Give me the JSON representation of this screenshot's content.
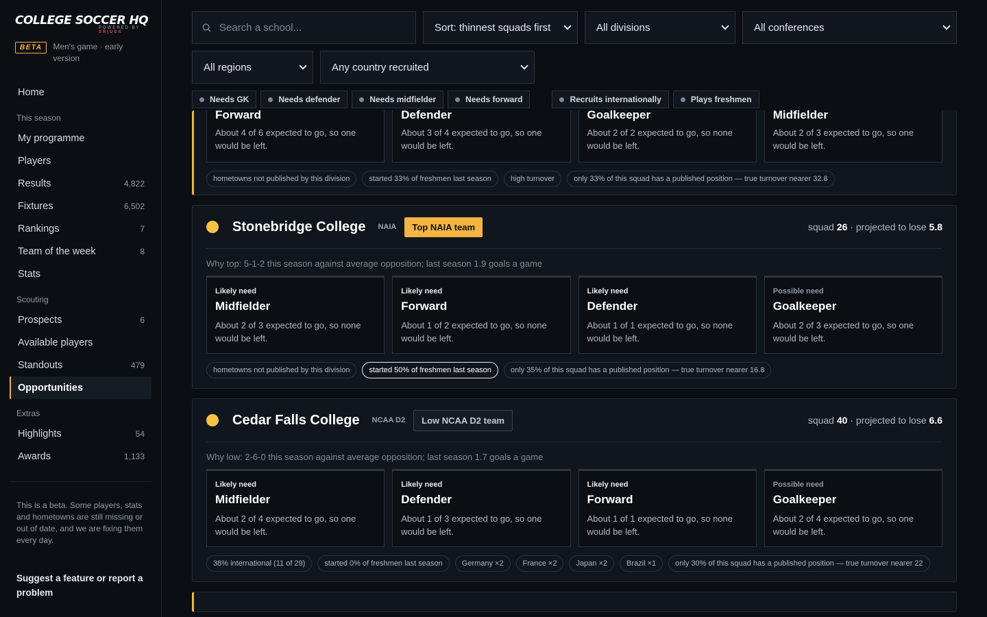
{
  "brand": {
    "logo": "College Soccer HQ",
    "powered_by": "powered by",
    "partner": "SR|USA",
    "beta_label": "BETA",
    "beta_note": "Men's game · early version"
  },
  "nav": {
    "home": "Home",
    "sections": [
      {
        "title": "This season",
        "items": [
          {
            "label": "My programme",
            "count": ""
          },
          {
            "label": "Players",
            "count": ""
          },
          {
            "label": "Results",
            "count": "4,822"
          },
          {
            "label": "Fixtures",
            "count": "6,502"
          },
          {
            "label": "Rankings",
            "count": "7"
          },
          {
            "label": "Team of the week",
            "count": "8"
          },
          {
            "label": "Stats",
            "count": ""
          }
        ]
      },
      {
        "title": "Scouting",
        "items": [
          {
            "label": "Prospects",
            "count": "6"
          },
          {
            "label": "Available players",
            "count": ""
          },
          {
            "label": "Standouts",
            "count": "479"
          },
          {
            "label": "Opportunities",
            "count": "",
            "active": true
          }
        ]
      },
      {
        "title": "Extras",
        "items": [
          {
            "label": "Highlights",
            "count": "54"
          },
          {
            "label": "Awards",
            "count": "1,133"
          }
        ]
      }
    ],
    "beta_disclaimer": "This is a beta. Some players, stats and hometowns are still missing or out of date, and we are fixing them every day.",
    "feedback_link": "Suggest a feature or report a problem"
  },
  "filters": {
    "search_placeholder": "Search a school...",
    "sort": "Sort: thinnest squads first",
    "division": "All divisions",
    "conference": "All conferences",
    "region": "All regions",
    "country": "Any country recruited",
    "chips_left": [
      "Needs GK",
      "Needs defender",
      "Needs midfielder",
      "Needs forward"
    ],
    "chips_right": [
      "Recruits internationally",
      "Plays freshmen"
    ]
  },
  "partial_card": {
    "needs": [
      {
        "position": "Forward",
        "desc": "About 4 of 6 expected to go, so one would be left."
      },
      {
        "position": "Defender",
        "desc": "About 3 of 4 expected to go, so one would be left."
      },
      {
        "position": "Goalkeeper",
        "desc": "About 2 of 2 expected to go, so none would be left."
      },
      {
        "position": "Midfielder",
        "desc": "About 2 of 3 expected to go, so one would be left."
      }
    ],
    "tags": [
      "hometowns not published by this division",
      "started 33% of freshmen last season",
      "high turnover",
      "only 33% of this squad has a published position — true turnover nearer 32.8"
    ]
  },
  "cards": [
    {
      "school": "Stonebridge College",
      "division": "NAIA",
      "rank_label": "Top NAIA team",
      "rank_kind": "top",
      "squad_prefix": "squad",
      "squad": "26",
      "lose_prefix": "· projected to lose",
      "lose": "5.8",
      "why": "Why top: 5-1-2 this season against average opposition; last season 1.9 goals a game",
      "needs": [
        {
          "kind": "Likely need",
          "position": "Midfielder",
          "desc": "About 2 of 3 expected to go, so none would be left."
        },
        {
          "kind": "Likely need",
          "position": "Forward",
          "desc": "About 1 of 2 expected to go, so none would be left."
        },
        {
          "kind": "Likely need",
          "position": "Defender",
          "desc": "About 1 of 1 expected to go, so none would be left."
        },
        {
          "kind": "Possible need",
          "position": "Goalkeeper",
          "desc": "About 2 of 3 expected to go, so one would be left."
        }
      ],
      "tags": [
        "hometowns not published by this division",
        "started 50% of freshmen last season",
        "only 35% of this squad has a published position — true turnover nearer 16.8"
      ],
      "selected_tag": 1
    },
    {
      "school": "Cedar Falls College",
      "division": "NCAA D2",
      "rank_label": "Low NCAA D2 team",
      "rank_kind": "low",
      "squad_prefix": "squad",
      "squad": "40",
      "lose_prefix": "· projected to lose",
      "lose": "6.6",
      "why": "Why low: 2-6-0 this season against average opposition; last season 1.7 goals a game",
      "needs": [
        {
          "kind": "Likely need",
          "position": "Midfielder",
          "desc": "About 2 of 4 expected to go, so one would be left."
        },
        {
          "kind": "Likely need",
          "position": "Defender",
          "desc": "About 1 of 3 expected to go, so one would be left."
        },
        {
          "kind": "Likely need",
          "position": "Forward",
          "desc": "About 1 of 1 expected to go, so none would be left."
        },
        {
          "kind": "Possible need",
          "position": "Goalkeeper",
          "desc": "About 2 of 4 expected to go, so one would be left."
        }
      ],
      "tags": [
        "38% international (11 of 29)",
        "started 0% of freshmen last season",
        "Germany ×2",
        "France ×2",
        "Japan ×2",
        "Brazil ×1",
        "only 30% of this squad has a published position — true turnover nearer 22"
      ],
      "selected_tag": -1
    }
  ],
  "colors": {
    "accent": "#f5b342",
    "indicator": "#f5c342",
    "bg": "#0b0f14"
  }
}
